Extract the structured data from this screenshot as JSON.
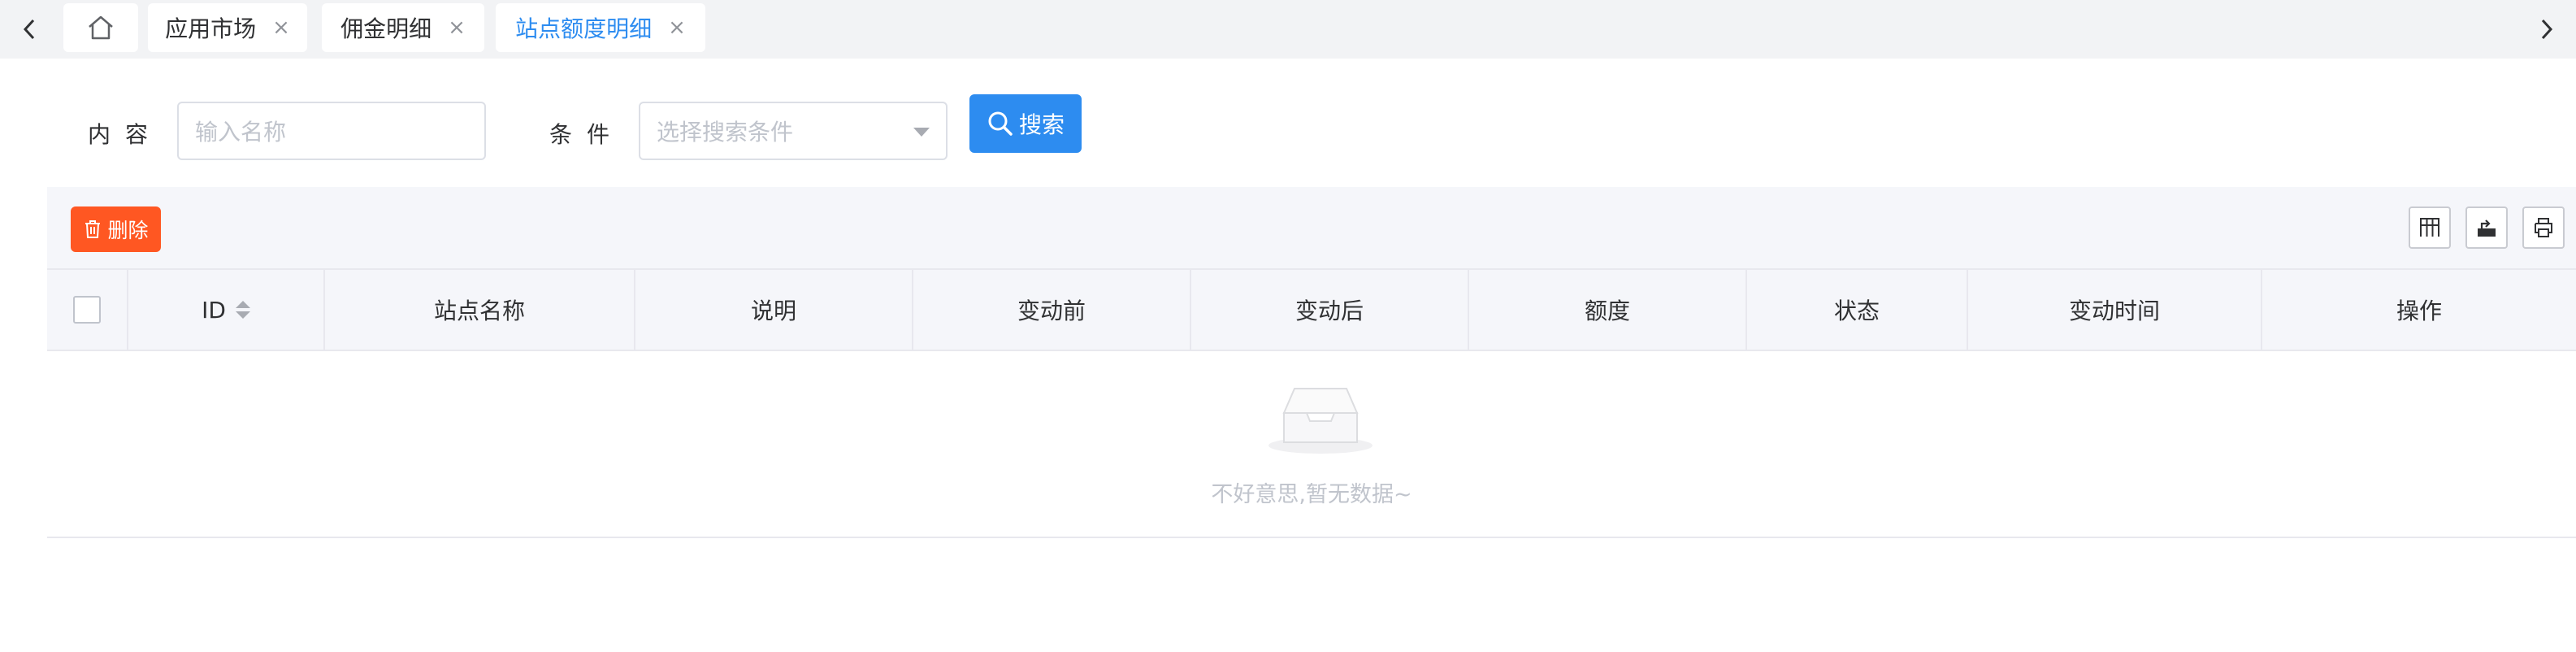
{
  "tabs": [
    {
      "label": ""
    },
    {
      "label": "应用市场"
    },
    {
      "label": "佣金明细"
    },
    {
      "label": "站点额度明细"
    }
  ],
  "tab_close_glyph": "×",
  "icons": {
    "nav_left": "chevron-left-icon",
    "nav_right": "chevron-right-icon",
    "home": "home-icon",
    "search": "search-icon",
    "delete": "trash-icon",
    "columns": "columns-icon",
    "export": "export-icon",
    "print": "print-icon",
    "empty": "empty-inbox-icon"
  },
  "search_form": {
    "content_label": "内容",
    "content_placeholder": "输入名称",
    "condition_label": "条件",
    "condition_placeholder": "选择搜索条件",
    "search_button": "搜索"
  },
  "toolbar": {
    "delete_button": "删除"
  },
  "table": {
    "columns": [
      "ID",
      "站点名称",
      "说明",
      "变动前",
      "变动后",
      "额度",
      "状态",
      "变动时间",
      "操作"
    ],
    "rows": [],
    "empty_text": "不好意思,暂无数据~"
  },
  "colors": {
    "primary": "#2d8cf0",
    "danger": "#ff5722",
    "header_bg": "#f5f6fa",
    "tabbar_bg": "#f2f3f5"
  }
}
